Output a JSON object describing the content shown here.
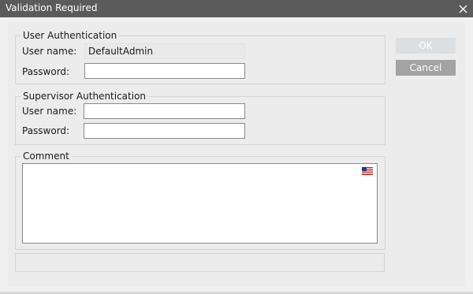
{
  "window": {
    "title": "Validation Required"
  },
  "user_auth": {
    "legend": "User Authentication",
    "username_label": "User name:",
    "username_value": "DefaultAdmin",
    "password_label": "Password:",
    "password_value": ""
  },
  "supervisor_auth": {
    "legend": "Supervisor Authentication",
    "username_label": "User name:",
    "username_value": "",
    "password_label": "Password:",
    "password_value": ""
  },
  "comment": {
    "legend": "Comment",
    "value": "",
    "language_icon": "us-flag-icon"
  },
  "buttons": {
    "ok_label": "OK",
    "cancel_label": "Cancel"
  },
  "colors": {
    "titlebar": "#5b5b5b",
    "ok_disabled": "#dcdfe2",
    "cancel": "#a3a3a3"
  }
}
